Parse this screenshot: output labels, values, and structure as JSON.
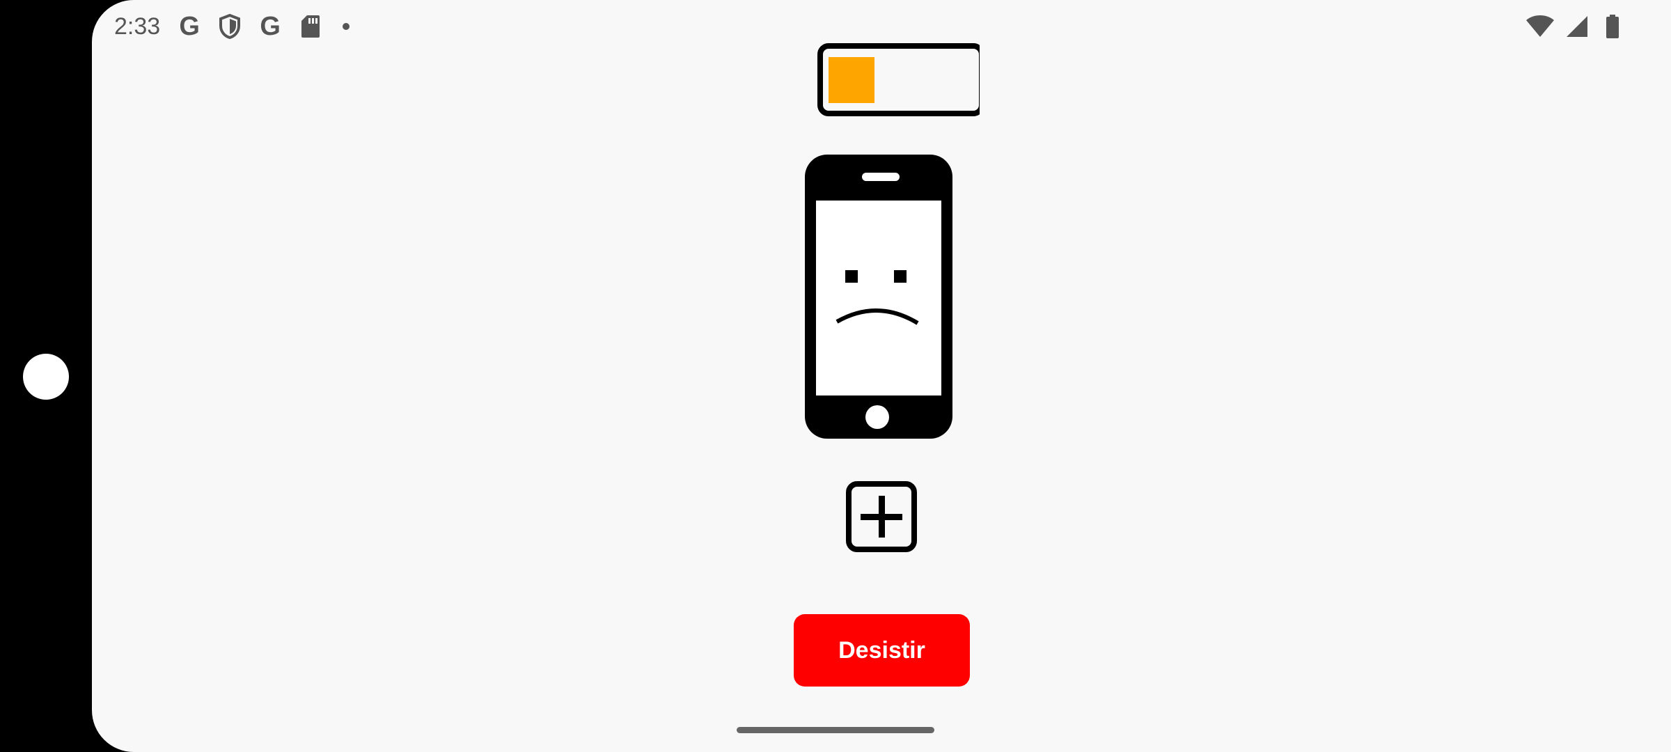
{
  "status_bar": {
    "time": "2:33",
    "google_letter_1": "G",
    "google_letter_2": "G",
    "left_icons": [
      "google-icon",
      "shield-icon",
      "google-icon",
      "sd-card-icon",
      "notification-dot"
    ],
    "right_icons": [
      "wifi-icon",
      "cellular-signal-icon",
      "battery-icon"
    ]
  },
  "main": {
    "battery_level_percent": 25,
    "battery_fill_color": "#FFA500",
    "phone_face": "sad-face",
    "add_button_icon": "plus-square-icon",
    "desistir_button": {
      "label": "Desistir",
      "color": "#FF0000"
    }
  }
}
